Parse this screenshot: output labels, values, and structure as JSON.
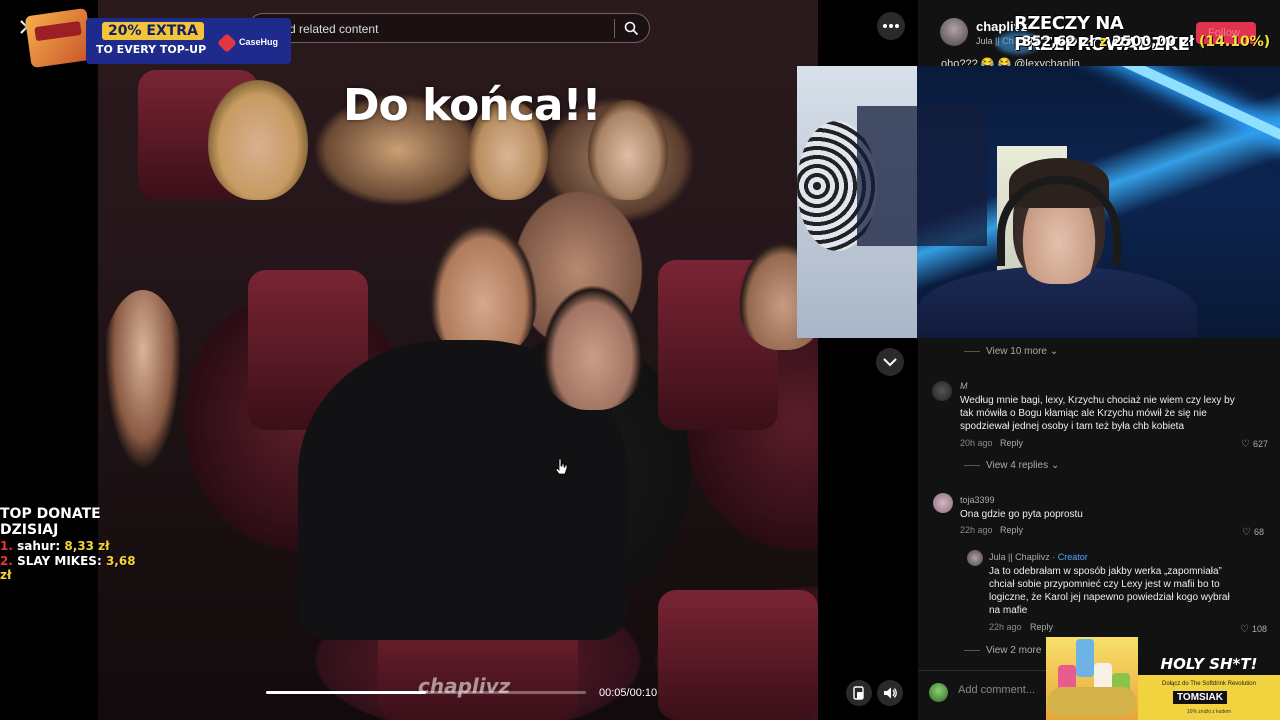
{
  "video": {
    "caption": "Do końca!!",
    "watermark": "chaplivz",
    "time": "00:05/00:10",
    "progress": 0.5
  },
  "search": {
    "placeholder": "d related content"
  },
  "ad_top": {
    "tag": "20% EXTRA",
    "sub": "TO EVERY TOP-UP",
    "brand": "CaseHug"
  },
  "donations": {
    "title": "TOP DONATE DZISIAJ",
    "entries": [
      {
        "rank": "1.",
        "name": "sahur:",
        "amount": "8,33 zł"
      },
      {
        "rank": "2.",
        "name": "SLAY MIKES:",
        "amount": "3,68 zł"
      }
    ]
  },
  "goal": {
    "title": "RZECZY NA PRZEPROWADZKE",
    "current": "352,62 zł",
    "separator": "z",
    "target": "2500,00 zł",
    "percent": "(14.10%)"
  },
  "author": {
    "name": "chaplivz",
    "sub": "Jula || Chaplivz",
    "follow_label": "Follow",
    "top_comment": "oho??? 😂 😂 @lexychaplin"
  },
  "comments": [
    {
      "view_more": "View 10 more",
      "name": "M",
      "text": "Według mnie bagi, lexy, Krzychu chociaż nie wiem czy lexy by tak mówiła o Bogu kłamiąc ale Krzychu mówił że się nie spodziewał jednej osoby i tam też była chb kobieta",
      "time": "20h ago",
      "reply": "Reply",
      "likes": "627",
      "replies_label": "View 4 replies"
    },
    {
      "name": "toja3399",
      "text": "Ona gdzie go pyta poprostu",
      "time": "22h ago",
      "reply": "Reply",
      "likes": "68"
    },
    {
      "name": "Jula || Chaplivz",
      "creator": "· Creator",
      "text": "Ja to odebrałam w sposób jakby werka „zapomniała” chciał sobie przypomnieć czy Lexy jest w mafii bo to logiczne, że Karol jej napewno powiedział kogo wybrał na mafie",
      "time": "22h ago",
      "reply": "Reply",
      "likes": "108",
      "replies_label": "View 2 more"
    }
  ],
  "comment_input": {
    "placeholder": "Add comment..."
  },
  "ad_bottom": {
    "title": "HOLY SH*T!",
    "sub": "Dołącz do The Softdrink Revolution",
    "brand": "TOMSIAK",
    "small": "10% zniżki z kodem"
  },
  "icons": [
    "close-icon",
    "search-icon",
    "more-icon",
    "chevron-down-icon",
    "screen-icon",
    "volume-icon",
    "heart-icon",
    "cursor-icon"
  ]
}
